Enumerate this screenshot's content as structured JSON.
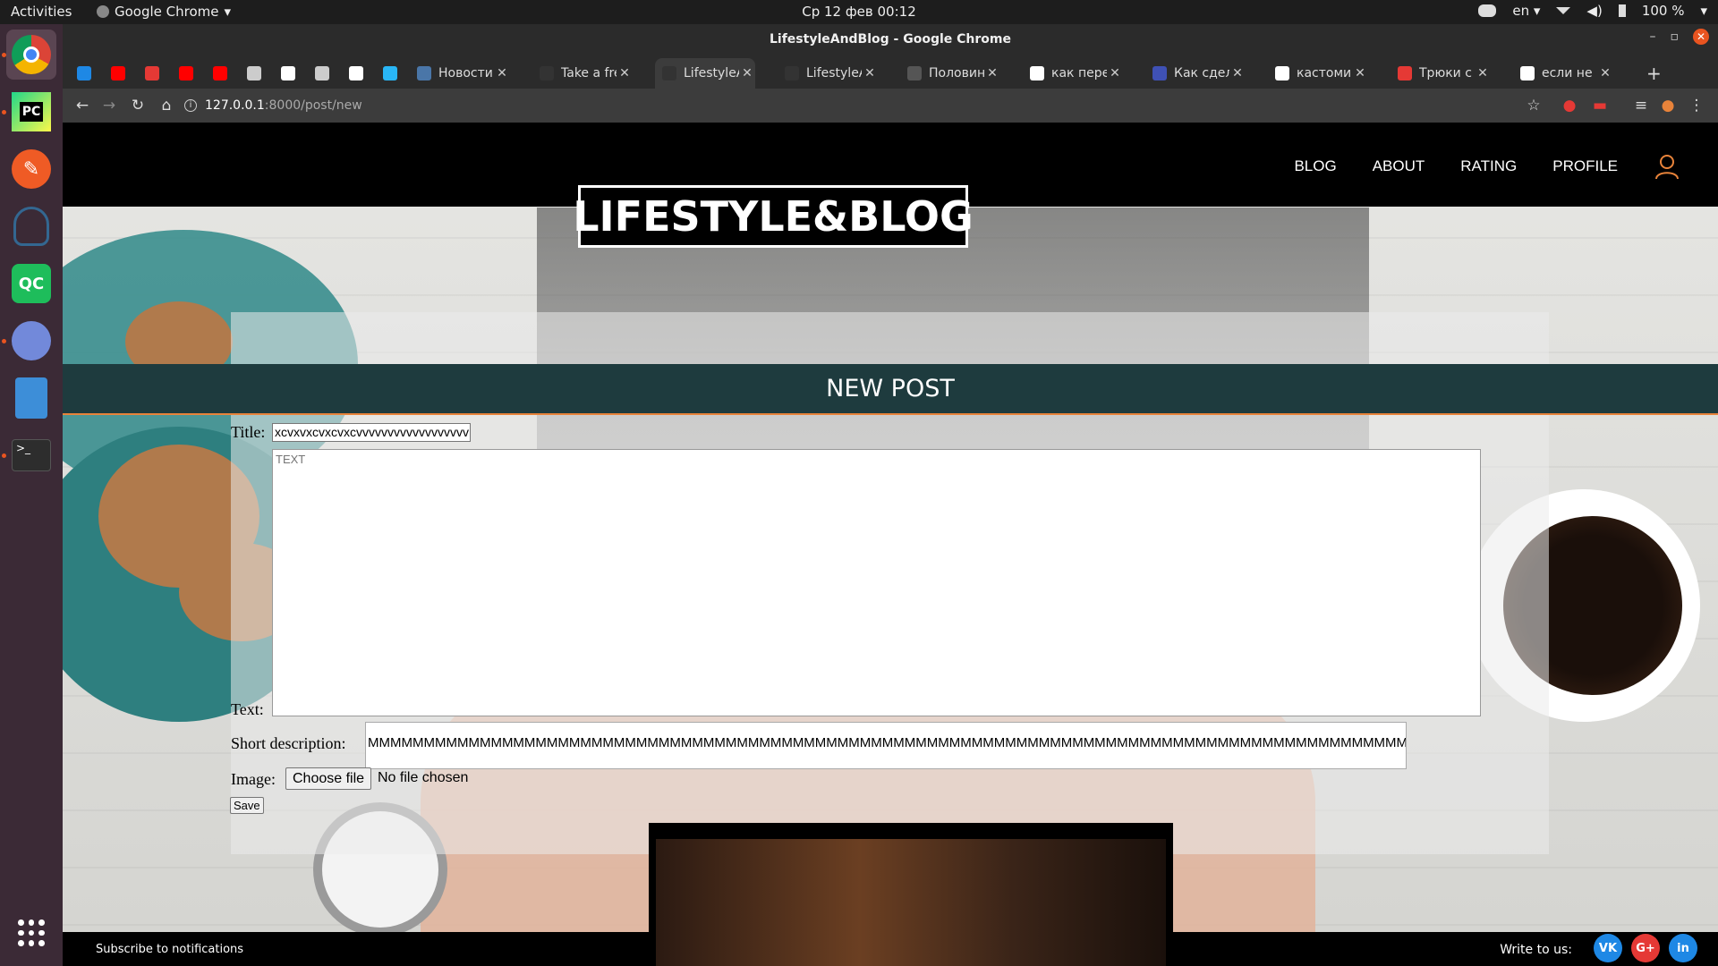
{
  "system": {
    "activities": "Activities",
    "app_menu": "Google Chrome",
    "clock": "Ср 12 фев  00:12",
    "lang": "en",
    "battery": "100 %"
  },
  "window": {
    "title": "LifestyleAndBlog - Google Chrome"
  },
  "tabs": [
    {
      "label": "",
      "icon": "tab-icon",
      "color": "#1e88e5"
    },
    {
      "label": "",
      "icon": "youtube-icon",
      "color": "#ff0000"
    },
    {
      "label": "",
      "icon": "bookmark-icon",
      "color": "#e53935"
    },
    {
      "label": "",
      "icon": "youtube-icon",
      "color": "#ff0000"
    },
    {
      "label": "",
      "icon": "youtube-icon",
      "color": "#ff0000"
    },
    {
      "label": "",
      "icon": "grid-icon",
      "color": "#cccccc"
    },
    {
      "label": "",
      "icon": "google-icon",
      "color": "#ffffff"
    },
    {
      "label": "",
      "icon": "calculator-icon",
      "color": "#cccccc"
    },
    {
      "label": "",
      "icon": "globe-icon",
      "color": "#ffffff"
    },
    {
      "label": "",
      "icon": "bookmark-icon",
      "color": "#29b6f6"
    },
    {
      "label": "Новости",
      "icon": "vk-icon",
      "color": "#4a76a8"
    },
    {
      "label": "Take a free",
      "icon": "ef-icon",
      "color": "#333333"
    },
    {
      "label": "LifestyleAnd",
      "icon": "globe-icon",
      "color": "#333333"
    },
    {
      "label": "LifestyleAnd",
      "icon": "globe-icon",
      "color": "#333333"
    },
    {
      "label": "Половин",
      "icon": "avatar-icon",
      "color": "#555555"
    },
    {
      "label": "как перене",
      "icon": "google-icon",
      "color": "#ffffff"
    },
    {
      "label": "Как сделат",
      "icon": "site-icon",
      "color": "#3f51b5"
    },
    {
      "label": "кастомиза",
      "icon": "google-icon",
      "color": "#ffffff"
    },
    {
      "label": "Трюки с te",
      "icon": "vivaldi-icon",
      "color": "#e53935"
    },
    {
      "label": "если не ве",
      "icon": "google-icon",
      "color": "#ffffff"
    }
  ],
  "omnibox": {
    "host": "127.0.0.1",
    "path": ":8000/post/new"
  },
  "site": {
    "logo": "LIFESTYLE&BLOG",
    "nav": [
      "BLOG",
      "ABOUT",
      "RATING",
      "PROFILE"
    ],
    "page_title": "NEW POST",
    "form": {
      "title_label": "Title:",
      "title_value": "xcvxvxcvxcvxcvvvvvvvvvvvvvvvvvv",
      "text_placeholder": "TEXT",
      "text_label": "Text:",
      "short_label": "Short description:",
      "short_value": "MMMMMMMMMMMMMMMMMMMMMMMMMMMMMMMMMMMMMMMMMMMMMMMMMMMMMMMMMMMMMMMMMMMMMMMMMMMMMMMMMMMMMMMMMMMMMMMMMMMMMM",
      "image_label": "Image:",
      "file_button": "Choose file",
      "file_status": "No file chosen",
      "save": "Save"
    },
    "footer": {
      "subscribe": "Subscribe to notifications",
      "write_us": "Write to us:"
    }
  },
  "colors": {
    "accent_orange": "#e8833a",
    "title_band": "#1e3b3e",
    "vk": "#1e88e5",
    "gplus": "#e53935",
    "linkedin": "#1e88e5"
  }
}
